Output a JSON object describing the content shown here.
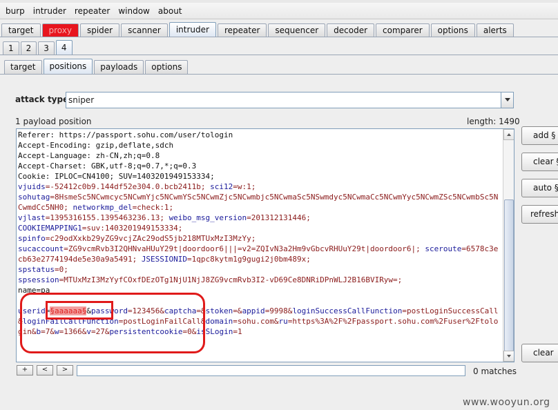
{
  "menu": [
    "burp",
    "intruder",
    "repeater",
    "window",
    "about"
  ],
  "main_tabs": [
    {
      "label": "target",
      "state": "normal"
    },
    {
      "label": "proxy",
      "state": "alert"
    },
    {
      "label": "spider",
      "state": "normal"
    },
    {
      "label": "scanner",
      "state": "normal"
    },
    {
      "label": "intruder",
      "state": "active"
    },
    {
      "label": "repeater",
      "state": "normal"
    },
    {
      "label": "sequencer",
      "state": "normal"
    },
    {
      "label": "decoder",
      "state": "normal"
    },
    {
      "label": "comparer",
      "state": "normal"
    },
    {
      "label": "options",
      "state": "normal"
    },
    {
      "label": "alerts",
      "state": "normal"
    }
  ],
  "instance_tabs": [
    "1",
    "2",
    "3",
    "4"
  ],
  "active_instance": "4",
  "sub_tabs": [
    "target",
    "positions",
    "payloads",
    "options"
  ],
  "active_sub_tab": "positions",
  "attack": {
    "label": "attack type",
    "value": "sniper"
  },
  "payload_count": "1 payload position",
  "length": "length: 1490",
  "request_lines": [
    [
      {
        "t": "Referer: https://passport.sohu.com/user/tologin",
        "c": ""
      }
    ],
    [
      {
        "t": "Accept-Encoding: gzip,deflate,sdch",
        "c": ""
      }
    ],
    [
      {
        "t": "Accept-Language: zh-CN,zh;q=0.8",
        "c": ""
      }
    ],
    [
      {
        "t": "Accept-Charset: GBK,utf-8;q=0.7,*;q=0.3",
        "c": ""
      }
    ],
    [
      {
        "t": "Cookie: IPLOC=CN4100; SUV=1403201949153334;",
        "c": ""
      }
    ],
    [
      {
        "t": "vjuids",
        "c": "k"
      },
      {
        "t": "=-52412c0b9.144df52e304.0.bcb2411b; ",
        "c": "v"
      },
      {
        "t": "sci12",
        "c": "k"
      },
      {
        "t": "=w:1;",
        "c": "v"
      }
    ],
    [
      {
        "t": "sohutag",
        "c": "k"
      },
      {
        "t": "=8HsmeSc5NCwmcyc5NCwmYjc5NCwmYSc5NCwmZjc5NCwmbjc5NCwmaSc5NSwmdyc5NCwmaCc5NCwmYyc5NCwmZSc5NCwmbSc5NCwmdCc5NH0; ",
        "c": "v"
      },
      {
        "t": "networkmp_del",
        "c": "k"
      },
      {
        "t": "=check:1;",
        "c": "v"
      }
    ],
    [
      {
        "t": "vjlast",
        "c": "k"
      },
      {
        "t": "=1395316155.1395463236.13; ",
        "c": "v"
      },
      {
        "t": "weibo_msg_version",
        "c": "k"
      },
      {
        "t": "=201312131446;",
        "c": "v"
      }
    ],
    [
      {
        "t": "COOKIEMAPPING1",
        "c": "k"
      },
      {
        "t": "=suv:1403201949153334;",
        "c": "v"
      }
    ],
    [
      {
        "t": "spinfo",
        "c": "k"
      },
      {
        "t": "=c29odXxkb29yZG9vcjZAc29odS5jb218MTUxMzI3MzYy;",
        "c": "v"
      }
    ],
    [
      {
        "t": "sucaccount",
        "c": "k"
      },
      {
        "t": "=ZG9vcmRvb3I2QHNvaHUuY29t|doordoor6|||=v2=ZQIvN3a2Hm9vGbcvRHUuY29t|doordoor6|; ",
        "c": "v"
      },
      {
        "t": "sceroute",
        "c": "k"
      },
      {
        "t": "=6578c3ecb63e2774194de5e30a9a5491; ",
        "c": "v"
      },
      {
        "t": "JSESSIONID",
        "c": "k"
      },
      {
        "t": "=1qpc8kytm1g9gugi2j0bm489x;",
        "c": "v"
      }
    ],
    [
      {
        "t": "spstatus",
        "c": "k"
      },
      {
        "t": "=0;",
        "c": "v"
      }
    ],
    [
      {
        "t": "spsession",
        "c": "k"
      },
      {
        "t": "=MTUxMzI3MzYyfCOxfDEzOTg1NjU1NjJ8ZG9vcmRvb3I2-vD69Ce8DNRiDPnWLJ2B16BVIRyw=;",
        "c": "v"
      }
    ],
    [
      {
        "t": "name=pa",
        "c": ""
      }
    ],
    [
      {
        "t": "",
        "c": ""
      }
    ],
    [
      {
        "t": "userid",
        "c": "k"
      },
      {
        "t": "=",
        "c": ""
      },
      {
        "t": "§aaaaaa§",
        "c": "pay"
      },
      {
        "t": "&",
        "c": ""
      },
      {
        "t": "password",
        "c": "k"
      },
      {
        "t": "=123456&",
        "c": "v"
      },
      {
        "t": "captcha",
        "c": "k"
      },
      {
        "t": "=&",
        "c": "v"
      },
      {
        "t": "stoken",
        "c": "k"
      },
      {
        "t": "=&",
        "c": "v"
      },
      {
        "t": "appid",
        "c": "k"
      },
      {
        "t": "=9998&",
        "c": "v"
      },
      {
        "t": "loginSuccessCallFunction",
        "c": "k"
      },
      {
        "t": "=postLoginSuccessCall&",
        "c": "v"
      },
      {
        "t": "loginFailCallFunction",
        "c": "k"
      },
      {
        "t": "=postLoginFailCall&",
        "c": "v"
      },
      {
        "t": "domain",
        "c": "k"
      },
      {
        "t": "=sohu.com&",
        "c": "v"
      },
      {
        "t": "ru",
        "c": "k"
      },
      {
        "t": "=https%3A%2F%2Fpassport.sohu.com%2Fuser%2Ftologin&",
        "c": "v"
      },
      {
        "t": "b",
        "c": "k"
      },
      {
        "t": "=7&",
        "c": "v"
      },
      {
        "t": "w",
        "c": "k"
      },
      {
        "t": "=1366&",
        "c": "v"
      },
      {
        "t": "v",
        "c": "k"
      },
      {
        "t": "=27&",
        "c": "v"
      },
      {
        "t": "persistentcookie",
        "c": "k"
      },
      {
        "t": "=0&",
        "c": "v"
      },
      {
        "t": "isSLogin",
        "c": "k"
      },
      {
        "t": "=1",
        "c": "v"
      }
    ]
  ],
  "side_buttons": [
    "add §",
    "clear §",
    "auto §",
    "refresh"
  ],
  "nav_buttons": [
    "+",
    "<",
    ">"
  ],
  "search": {
    "value": ""
  },
  "matches": "0 matches",
  "clear_button": "clear",
  "watermark": "www.wooyun.org"
}
